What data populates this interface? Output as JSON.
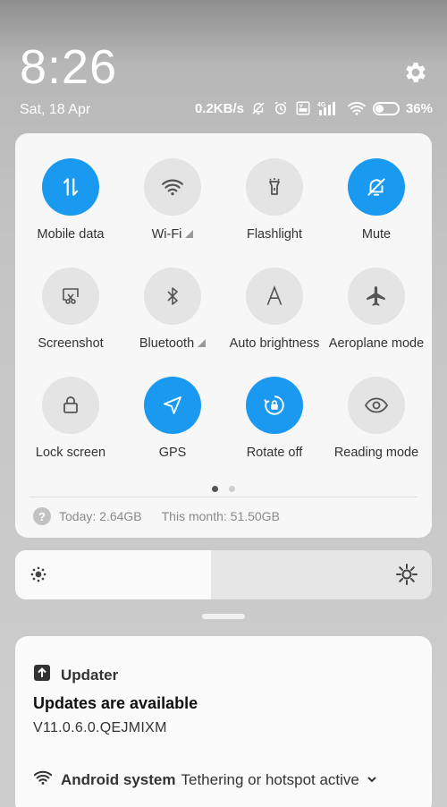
{
  "status_bar": {
    "time": "8:26",
    "date": "Sat, 18 Apr",
    "net_speed": "0.2KB/s",
    "battery": "36%",
    "battery_level": 0.36
  },
  "tiles": [
    {
      "label": "Mobile data",
      "icon": "mobile-data-icon",
      "active": true
    },
    {
      "label": "Wi-Fi",
      "icon": "wifi-icon",
      "active": false
    },
    {
      "label": "Flashlight",
      "icon": "flashlight-icon",
      "active": false
    },
    {
      "label": "Mute",
      "icon": "mute-bell-icon",
      "active": true
    },
    {
      "label": "Screenshot",
      "icon": "screenshot-icon",
      "active": false
    },
    {
      "label": "Bluetooth",
      "icon": "bluetooth-icon",
      "active": false
    },
    {
      "label": "Auto brightness",
      "icon": "auto-brightness-icon",
      "active": false
    },
    {
      "label": "Aeroplane mode",
      "icon": "aeroplane-icon",
      "active": false
    },
    {
      "label": "Lock screen",
      "icon": "lock-icon",
      "active": false
    },
    {
      "label": "GPS",
      "icon": "gps-icon",
      "active": true
    },
    {
      "label": "Rotate off",
      "icon": "rotate-lock-icon",
      "active": true
    },
    {
      "label": "Reading mode",
      "icon": "eye-icon",
      "active": false
    }
  ],
  "data_usage": {
    "help": "?",
    "today": "Today: 2.64GB",
    "month": "This month: 51.50GB"
  },
  "brightness": {
    "level": 0.47
  },
  "notifications": {
    "updater": {
      "app": "Updater",
      "title": "Updates are available",
      "text": "V11.0.6.0.QEJMIXM"
    },
    "system": {
      "app": "Android system",
      "text": "Tethering or hotspot active"
    }
  },
  "colors": {
    "accent": "#1a99f0",
    "tile_inactive": "#e4e4e4",
    "panel": "#f7f7f7"
  }
}
